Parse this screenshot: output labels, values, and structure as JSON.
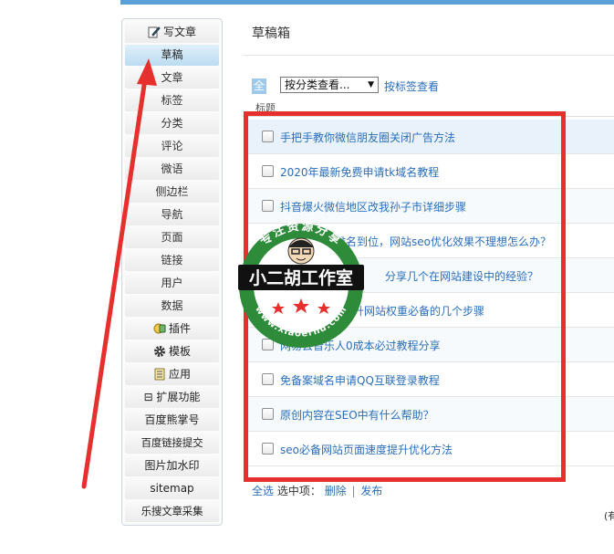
{
  "sidebar": {
    "items": [
      {
        "label": "写文章",
        "icon": "pencil-icon",
        "active": false
      },
      {
        "label": "草稿",
        "active": true
      },
      {
        "label": "文章"
      },
      {
        "label": "标签"
      },
      {
        "label": "分类"
      },
      {
        "label": "评论"
      },
      {
        "label": "微语"
      },
      {
        "label": "侧边栏"
      },
      {
        "label": "导航"
      },
      {
        "label": "页面"
      },
      {
        "label": "链接"
      },
      {
        "label": "用户"
      },
      {
        "label": "数据"
      },
      {
        "label": "插件",
        "icon": "plugin-icon"
      },
      {
        "label": "模板",
        "icon": "gear-icon"
      },
      {
        "label": "应用",
        "icon": "app-icon"
      },
      {
        "label": "⊟ 扩展功能"
      },
      {
        "label": "百度熊掌号"
      },
      {
        "label": "百度链接提交"
      },
      {
        "label": "图片加水印"
      },
      {
        "label": "sitemap"
      },
      {
        "label": "乐搜文章采集"
      }
    ]
  },
  "main": {
    "title": "草稿箱",
    "filter": {
      "all_label": "全部",
      "category_select": "按分类查看...",
      "tag_link": "按标签查看"
    },
    "table_header": "标题",
    "rows": [
      "手把手教你微信朋友圈关闭广告方法",
      "2020年最新免费申请tk域名教程",
      "抖音爆火微信地区改我孙子市详细步骤",
      "网站关键词排名到位，网站seo优化效果不理想怎么办？",
      "分享几个在网站建设中的经验？",
      "提升网站权重必备的几个步骤",
      "网易云音乐人0成本必过教程分享",
      "免备案域名申请QQ互联登录教程",
      "原创内容在SEO中有什么帮助？",
      "seo必备网站页面速度提升优化方法"
    ],
    "actions": {
      "select_all": "全选",
      "selected_label": "选中项：",
      "delete": "删除",
      "separator": "|",
      "publish": "发布"
    },
    "corner_text": "(有"
  },
  "watermark": {
    "top_text": "专注资源分享",
    "main_text": "小二胡工作室",
    "url_text": "www.xiaoerhu.com"
  },
  "colors": {
    "accent_red": "#e5302e",
    "link_blue": "#2a6ebb",
    "active_bg": "#bcdcf1",
    "badge_green": "#2e8b3a"
  }
}
